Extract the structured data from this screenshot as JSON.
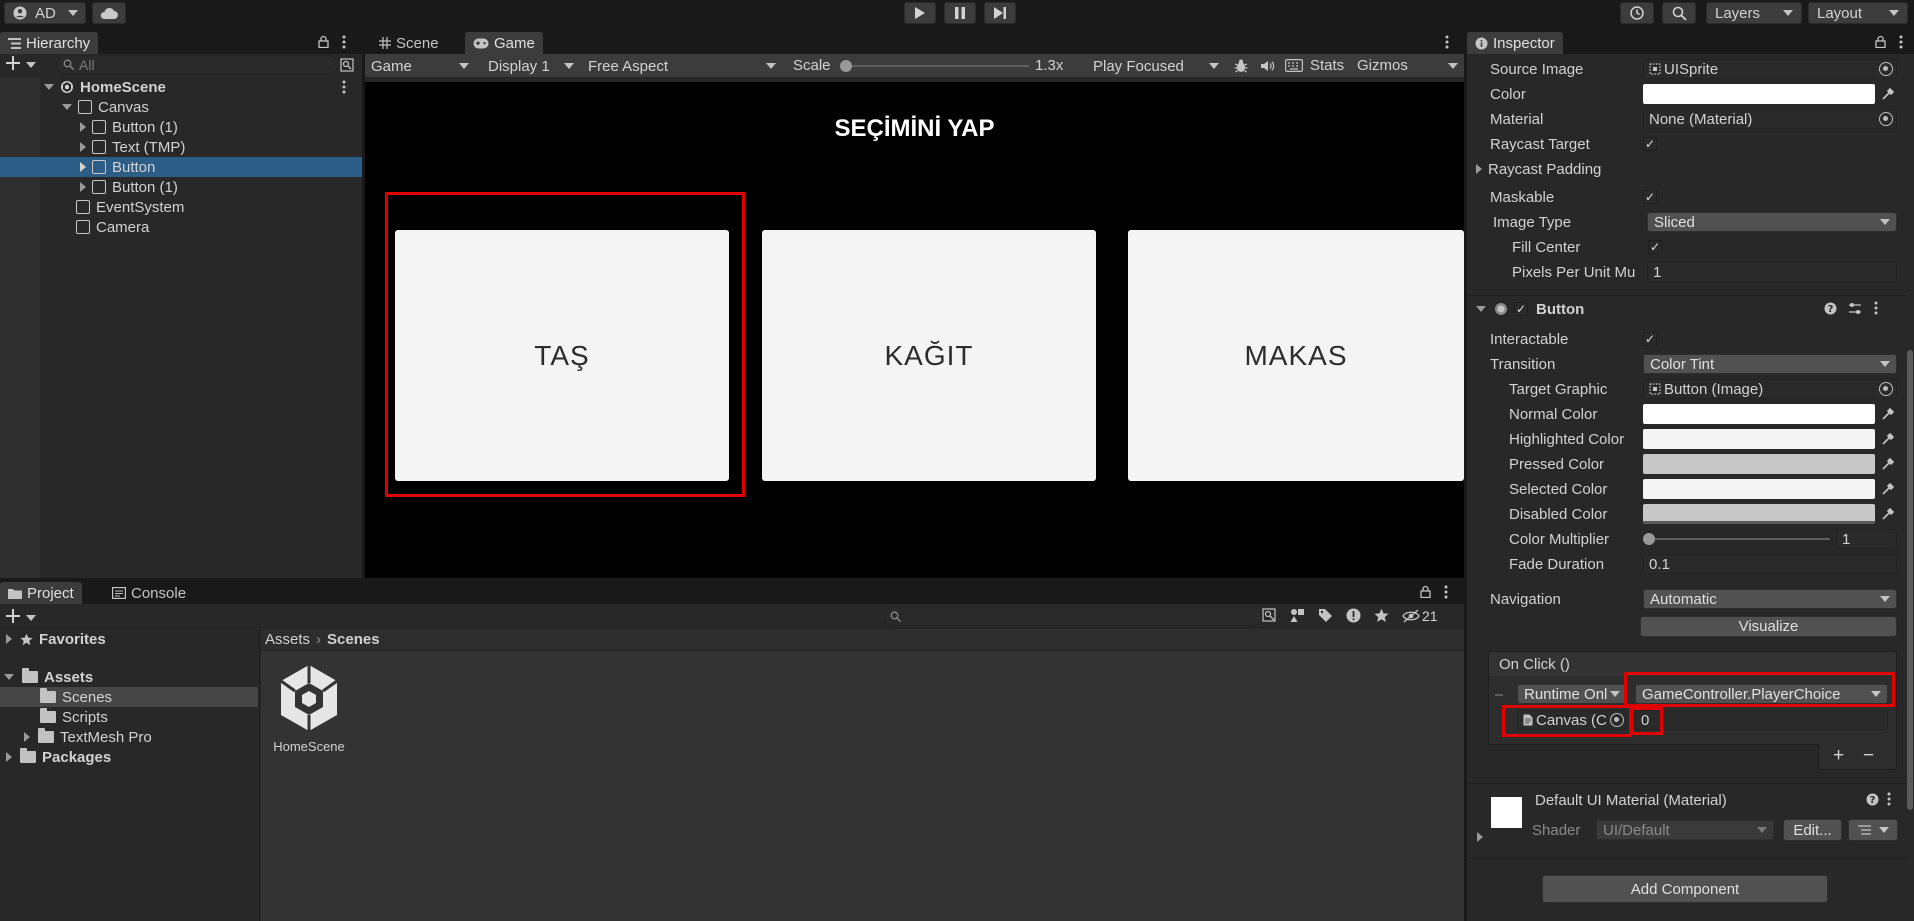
{
  "toolbar": {
    "account": "AD",
    "layers": "Layers",
    "layout": "Layout"
  },
  "hierarchy": {
    "tab": "Hierarchy",
    "search_placeholder": "All",
    "scene": "HomeScene",
    "items": [
      "Canvas",
      "Button (1)",
      "Text (TMP)",
      "Button",
      "Button (1)",
      "EventSystem",
      "Camera"
    ]
  },
  "scene_tabs": {
    "scene": "Scene",
    "game": "Game"
  },
  "game_bar": {
    "mode": "Game",
    "display": "Display 1",
    "aspect": "Free Aspect",
    "scale_label": "Scale",
    "scale_value": "1.3x",
    "play_focus": "Play Focused",
    "stats": "Stats",
    "gizmos": "Gizmos"
  },
  "game": {
    "heading": "SEÇİMİNİ YAP",
    "buttons": [
      "TAŞ",
      "KAĞIT",
      "MAKAS"
    ]
  },
  "inspector": {
    "tab": "Inspector",
    "image": {
      "source_image_label": "Source Image",
      "source_image": "UISprite",
      "color_label": "Color",
      "material_label": "Material",
      "material": "None (Material)",
      "raycast_target": "Raycast Target",
      "raycast_padding": "Raycast Padding",
      "maskable": "Maskable",
      "image_type_label": "Image Type",
      "image_type": "Sliced",
      "fill_center": "Fill Center",
      "ppu_label": "Pixels Per Unit Mu",
      "ppu": "1"
    },
    "button": {
      "title": "Button",
      "interactable": "Interactable",
      "transition_label": "Transition",
      "transition": "Color Tint",
      "target_graphic_label": "Target Graphic",
      "target_graphic": "Button (Image)",
      "normal": "Normal Color",
      "highlighted": "Highlighted Color",
      "pressed": "Pressed Color",
      "selected": "Selected Color",
      "disabled": "Disabled Color",
      "multiplier_label": "Color Multiplier",
      "multiplier": "1",
      "fade_label": "Fade Duration",
      "fade": "0.1",
      "navigation_label": "Navigation",
      "navigation": "Automatic",
      "visualize": "Visualize",
      "onclick": "On Click ()",
      "runtime": "Runtime Onl",
      "function": "GameController.PlayerChoice",
      "object": "Canvas (C",
      "arg": "0",
      "plus": "+",
      "minus": "−"
    },
    "material": {
      "name": "Default UI Material (Material)",
      "shader_label": "Shader",
      "shader": "UI/Default",
      "edit": "Edit..."
    },
    "add_component": "Add Component"
  },
  "project": {
    "tab": "Project",
    "console_tab": "Console",
    "hidden_count": "21",
    "favorites": "Favorites",
    "assets": "Assets",
    "folders": [
      "Scenes",
      "Scripts",
      "TextMesh Pro"
    ],
    "packages": "Packages",
    "breadcrumb": [
      "Assets",
      "Scenes"
    ],
    "asset_name": "HomeScene"
  },
  "colors": {
    "accent_selected": "#2c5d87",
    "highlight": "#e00000"
  }
}
